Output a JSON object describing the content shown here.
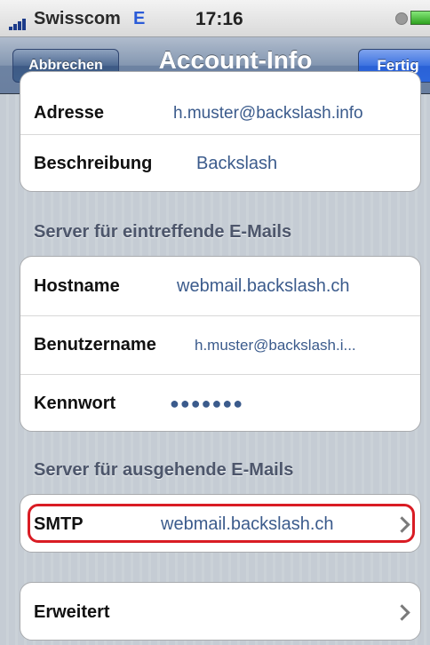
{
  "status_bar": {
    "carrier": "Swisscom",
    "network": "E",
    "time": "17:16"
  },
  "nav": {
    "cancel_label": "Abbrechen",
    "title": "Account-Info",
    "done_label": "Fertig"
  },
  "account": {
    "address_label": "Adresse",
    "address_value": "h.muster@backslash.info",
    "description_label": "Beschreibung",
    "description_value": "Backslash"
  },
  "incoming": {
    "header": "Server für eintreffende E-Mails",
    "hostname_label": "Hostname",
    "hostname_value": "webmail.backslash.ch",
    "username_label": "Benutzername",
    "username_value": "h.muster@backslash.i...",
    "password_label": "Kennwort",
    "password_value": "●●●●●●●"
  },
  "outgoing": {
    "header": "Server für ausgehende E-Mails",
    "smtp_label": "SMTP",
    "smtp_value": "webmail.backslash.ch"
  },
  "advanced": {
    "label": "Erweitert"
  },
  "icons": {
    "signal": "signal-bars-icon",
    "alarm": "alarm-icon",
    "battery": "battery-icon",
    "chevron": "chevron-right-icon"
  },
  "colors": {
    "value_text": "#3b5b8c",
    "highlight": "#d91c24",
    "done_button": "#2a61d6"
  }
}
